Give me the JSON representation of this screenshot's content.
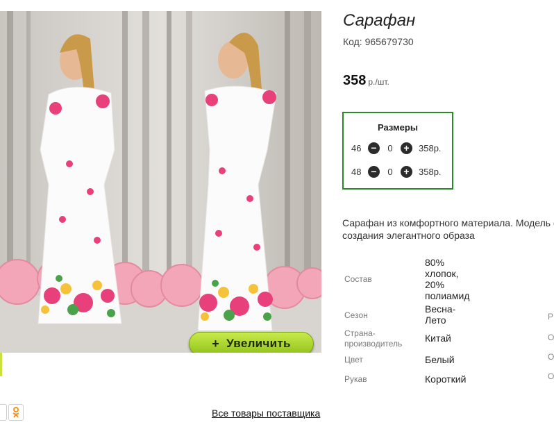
{
  "product": {
    "title": "Сарафан",
    "code": "Код: 965679730",
    "price": "358",
    "price_unit": "р./шт.",
    "description": "Сарафан из комфортного материала. Модель с",
    "description_line2": "создания элегантного образа"
  },
  "zoom_button": {
    "label": "Увеличить",
    "icon": "plus-icon"
  },
  "sizes": {
    "title": "Размеры",
    "rows": [
      {
        "size": "46",
        "qty": "0",
        "price": "358р."
      },
      {
        "size": "48",
        "qty": "0",
        "price": "358р."
      }
    ]
  },
  "specs": [
    {
      "label": "Состав",
      "value_lines": [
        "80%",
        "хлопок,",
        "20%",
        "полиамид"
      ]
    },
    {
      "label": "Сезон",
      "value_lines": [
        "Весна-",
        "Лето"
      ]
    },
    {
      "label_lines": [
        "Страна-",
        "производитель"
      ],
      "value_lines": [
        "Китай"
      ]
    },
    {
      "label": "Цвет",
      "value_lines": [
        "Белый"
      ]
    },
    {
      "label": "Рукав",
      "value_lines": [
        "Короткий"
      ]
    }
  ],
  "clipped_letters": [
    "Р",
    "О",
    "О",
    "О"
  ],
  "footer": {
    "all_goods_link": "Все товары поставщика"
  },
  "colors": {
    "accent_green": "#2a8a2a",
    "zoom_button": "#a6d22f",
    "odnoklassniki": "#f7931e"
  },
  "icons": {
    "share": "share-icon",
    "ok": "odnoklassniki-icon"
  }
}
